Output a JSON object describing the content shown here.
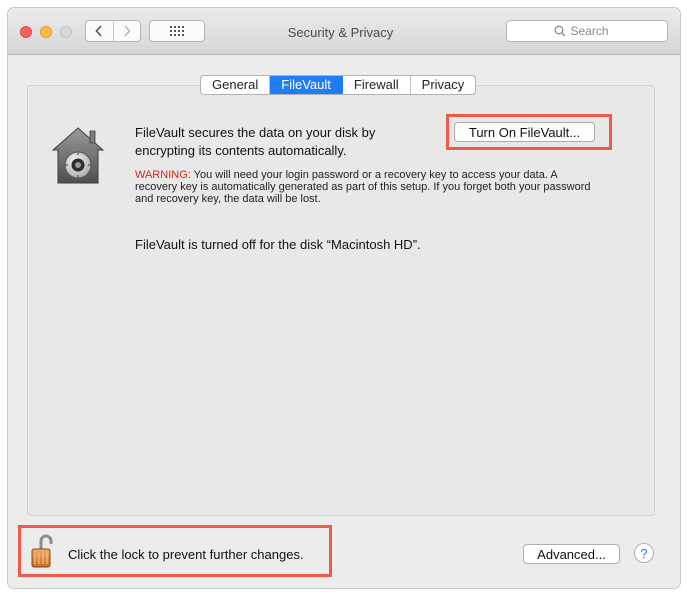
{
  "window": {
    "title": "Security & Privacy"
  },
  "toolbar": {
    "back_icon": "chevron-left-icon",
    "forward_icon": "chevron-right-icon",
    "grid_icon": "grid-icon",
    "search_placeholder": "Search"
  },
  "tabs": [
    {
      "label": "General",
      "active": false
    },
    {
      "label": "FileVault",
      "active": true
    },
    {
      "label": "Firewall",
      "active": false
    },
    {
      "label": "Privacy",
      "active": false
    }
  ],
  "filevault": {
    "description": "FileVault secures the data on your disk by encrypting its contents automatically.",
    "turn_on_label": "Turn On FileVault...",
    "warning_label": "WARNING:",
    "warning_text": " You will need your login password or a recovery key to access your data. A recovery key is automatically generated as part of this setup. If you forget both your password and recovery key, the data will be lost.",
    "status": "FileVault is turned off for the disk “Macintosh HD”."
  },
  "footer": {
    "lock_text": "Click the lock to prevent further changes.",
    "advanced_label": "Advanced...",
    "help_label": "?"
  },
  "colors": {
    "accent": "#1e7df7",
    "warning": "#d0291a",
    "highlight": "#ef5a4c"
  }
}
